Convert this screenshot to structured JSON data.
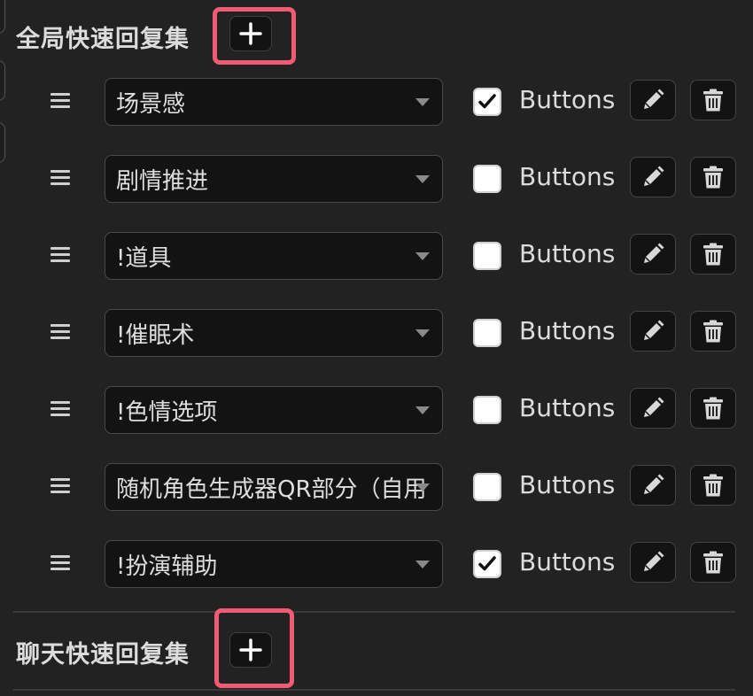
{
  "global_section": {
    "title": "全局快速回复集"
  },
  "chat_section": {
    "title": "聊天快速回复集"
  },
  "rows": [
    {
      "preset": "场景感",
      "checked": true,
      "checkbox_label": "Buttons"
    },
    {
      "preset": "剧情推进",
      "checked": false,
      "checkbox_label": "Buttons"
    },
    {
      "preset": "!道具",
      "checked": false,
      "checkbox_label": "Buttons"
    },
    {
      "preset": "!催眠术",
      "checked": false,
      "checkbox_label": "Buttons"
    },
    {
      "preset": "!色情选项",
      "checked": false,
      "checkbox_label": "Buttons"
    },
    {
      "preset": "随机角色生成器QR部分（自用）",
      "checked": false,
      "checkbox_label": "Buttons"
    },
    {
      "preset": "!扮演辅助",
      "checked": true,
      "checkbox_label": "Buttons"
    }
  ],
  "icons": {
    "add": "plus-icon",
    "drag": "drag-handle-icon",
    "edit": "pencil-icon",
    "delete": "trash-icon",
    "dropdown": "chevron-down-icon",
    "check": "check-icon"
  },
  "colors": {
    "background": "#222222",
    "highlight": "#f05a72",
    "control_bg": "#131313"
  }
}
